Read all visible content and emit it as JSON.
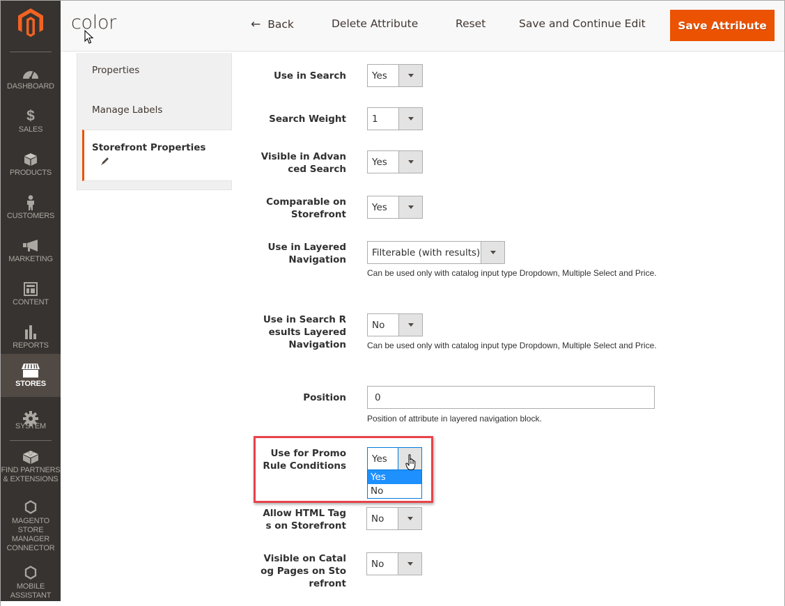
{
  "sidebar": {
    "logo": "magento-logo",
    "items": [
      {
        "label": "DASHBOARD",
        "icon": "dashboard-icon",
        "active": false
      },
      {
        "label": "SALES",
        "icon": "dollar-icon",
        "active": false
      },
      {
        "label": "PRODUCTS",
        "icon": "box-icon",
        "active": false
      },
      {
        "label": "CUSTOMERS",
        "icon": "person-icon",
        "active": false
      },
      {
        "label": "MARKETING",
        "icon": "megaphone-icon",
        "active": false
      },
      {
        "label": "CONTENT",
        "icon": "layout-icon",
        "active": false
      },
      {
        "label": "REPORTS",
        "icon": "bar-chart-icon",
        "active": false
      },
      {
        "label": "STORES",
        "icon": "storefront-icon",
        "active": true
      },
      {
        "label": "SYSTEM",
        "icon": "gear-icon",
        "active": false
      },
      {
        "label": "FIND PARTNERS\n& EXTENSIONS",
        "icon": "lego-brick-icon",
        "active": false
      },
      {
        "label": "MAGENTO\nSTORE\nMANAGER\nCONNECTOR",
        "icon": "hexagon-icon",
        "active": false
      },
      {
        "label": "MOBILE\nASSISTANT",
        "icon": "hexagon-icon",
        "active": false
      }
    ]
  },
  "header": {
    "title": "color",
    "back_label": "Back",
    "delete_label": "Delete Attribute",
    "reset_label": "Reset",
    "save_continue_label": "Save and Continue Edit",
    "save_label": "Save Attribute",
    "accent_color": "#eb5202"
  },
  "tabs": [
    {
      "label": "Properties",
      "active": false
    },
    {
      "label": "Manage Labels",
      "active": false
    },
    {
      "label": "Storefront Properties",
      "active": true,
      "icon": "pencil-icon"
    }
  ],
  "form": {
    "use_in_search": {
      "label": "Use in Search",
      "value": "Yes"
    },
    "search_weight": {
      "label": "Search Weight",
      "value": "1"
    },
    "visible_advanced_search": {
      "label_lines": [
        "Visible in Advan",
        "ced Search"
      ],
      "value": "Yes"
    },
    "comparable_storefront": {
      "label_lines": [
        "Comparable on",
        "Storefront"
      ],
      "value": "Yes"
    },
    "layered_navigation": {
      "label_lines": [
        "Use in Layered",
        "Navigation"
      ],
      "value": "Filterable (with results)",
      "note": "Can be used only with catalog input type Dropdown, Multiple Select and Price."
    },
    "search_results_layered_nav": {
      "label_lines": [
        "Use in Search R",
        "esults Layered",
        "Navigation"
      ],
      "value": "No",
      "note": "Can be used only with catalog input type Dropdown, Multiple Select and Price."
    },
    "position": {
      "label": "Position",
      "value": "0",
      "note": "Position of attribute in layered navigation block."
    },
    "promo_rule_conditions": {
      "label_lines": [
        "Use for Promo",
        "Rule Conditions"
      ],
      "value": "Yes",
      "open": true,
      "options": [
        "Yes",
        "No"
      ],
      "highlighted_option": "Yes"
    },
    "allow_html_tags": {
      "label_lines": [
        "Allow HTML Tag",
        "s on Storefront"
      ],
      "value": "No"
    },
    "visible_catalog_pages": {
      "label_lines": [
        "Visible on Catal",
        "og Pages on Sto",
        "refront"
      ],
      "value": "No"
    }
  },
  "colors": {
    "sidebar_bg": "#373330",
    "sidebar_active": "#514943",
    "highlight_box": "#e8434a",
    "option_selected": "#1e90ff"
  }
}
